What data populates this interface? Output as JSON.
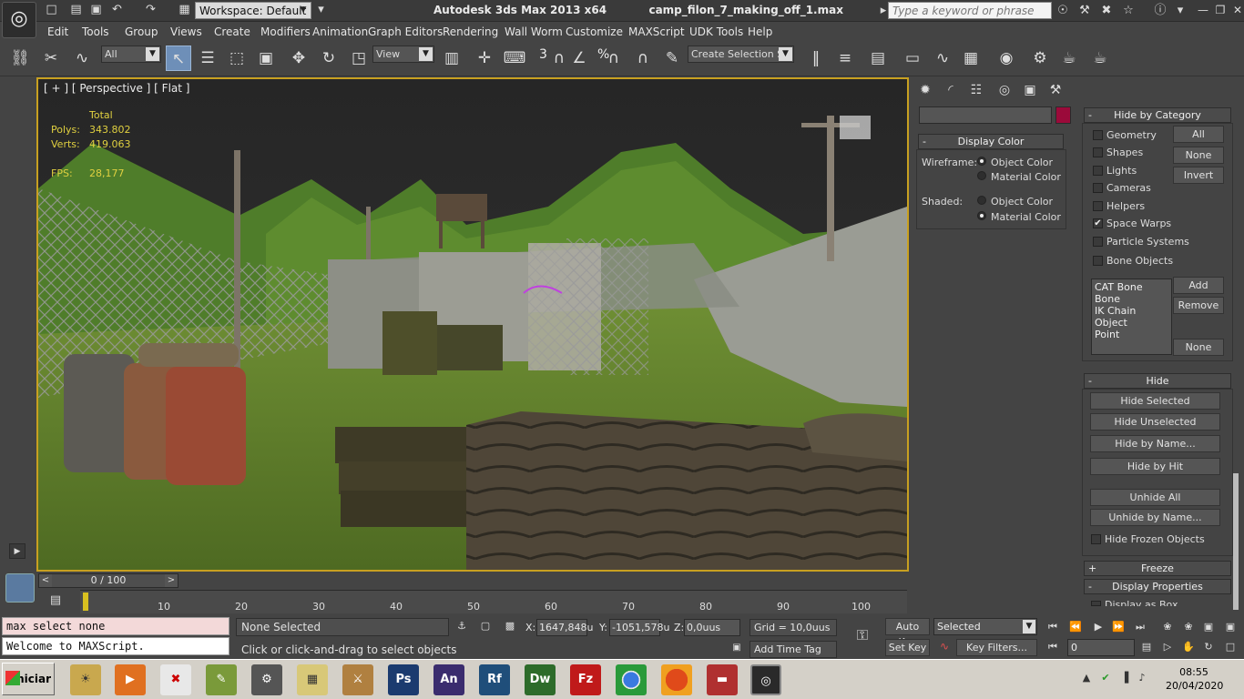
{
  "titlebar": {
    "workspace": "Workspace: Default",
    "app_title": "Autodesk 3ds Max  2013 x64",
    "file_name": "camp_filon_7_making_off_1.max",
    "search_placeholder": "Type a keyword or phrase"
  },
  "menus": [
    "Edit",
    "Tools",
    "Group",
    "Views",
    "Create",
    "Modifiers",
    "Animation",
    "Graph Editors",
    "Rendering",
    "Wall Worm",
    "Customize",
    "MAXScript",
    "UDK Tools",
    "Help"
  ],
  "toolbar": {
    "selection_filter": "All",
    "reference_coord": "View",
    "snap_angle_num": "3",
    "snap_percent": "%",
    "named_selection": "Create Selection Se"
  },
  "viewport": {
    "label": "[ + ] [ Perspective ] [ Flat ]",
    "stats": {
      "total_label": "Total",
      "polys_label": "Polys:",
      "polys_value": "343.802",
      "verts_label": "Verts:",
      "verts_value": "419.063",
      "fps_label": "FPS:",
      "fps_value": "28,177"
    }
  },
  "command_panel": {
    "swatch_color": "#9b0a3a",
    "display_color": {
      "title": "Display Color",
      "wireframe_label": "Wireframe:",
      "shaded_label": "Shaded:",
      "opt_object": "Object Color",
      "opt_material": "Material Color"
    },
    "hide_by_category": {
      "title": "Hide by Category",
      "items": [
        {
          "label": "Geometry",
          "checked": false
        },
        {
          "label": "Shapes",
          "checked": false
        },
        {
          "label": "Lights",
          "checked": false
        },
        {
          "label": "Cameras",
          "checked": false
        },
        {
          "label": "Helpers",
          "checked": false
        },
        {
          "label": "Space Warps",
          "checked": true
        },
        {
          "label": "Particle Systems",
          "checked": false
        },
        {
          "label": "Bone Objects",
          "checked": false
        }
      ],
      "btn_all": "All",
      "btn_none": "None",
      "btn_invert": "Invert",
      "list_items": [
        "CAT Bone",
        "Bone",
        "IK Chain Object",
        "Point"
      ],
      "btn_add": "Add",
      "btn_remove": "Remove",
      "btn_none2": "None"
    },
    "hide": {
      "title": "Hide",
      "buttons": [
        "Hide Selected",
        "Hide Unselected",
        "Hide by Name...",
        "Hide by Hit",
        "Unhide All",
        "Unhide by Name..."
      ],
      "frozen_label": "Hide Frozen Objects"
    },
    "freeze": {
      "title": "Freeze",
      "sign": "+"
    },
    "display_properties": {
      "title": "Display Properties",
      "first_item": "Display as Box"
    }
  },
  "timeline": {
    "slider_text": "0 / 100",
    "ticks": [
      "10",
      "20",
      "30",
      "40",
      "50",
      "60",
      "70",
      "80",
      "90",
      "100"
    ]
  },
  "status": {
    "mxs_input": "max select none",
    "mxs_output": "Welcome to MAXScript.",
    "selection": "None Selected",
    "prompt": "Click or click-and-drag to select objects",
    "x_label": "X:",
    "x_value": "1647,848u",
    "y_label": "Y:",
    "y_value": "-1051,578u",
    "z_label": "Z:",
    "z_value": "0,0uus",
    "grid": "Grid = 10,0uus",
    "add_time_tag": "Add Time Tag",
    "auto_key": "Auto Key",
    "set_key": "Set Key",
    "key_mode": "Selected",
    "key_filters": "Key Filters...",
    "frame": "0"
  },
  "taskbar": {
    "start": "Iniciar",
    "apps": [
      {
        "name": "Ps",
        "color": "#1b3b6f"
      },
      {
        "name": "An",
        "color": "#3a2c6e"
      },
      {
        "name": "Rf",
        "color": "#1f4e7a"
      },
      {
        "name": "Dw",
        "color": "#2d6b2a"
      },
      {
        "name": "Fz",
        "color": "#c01a1a"
      }
    ],
    "time": "08:55",
    "date": "20/04/2020"
  }
}
